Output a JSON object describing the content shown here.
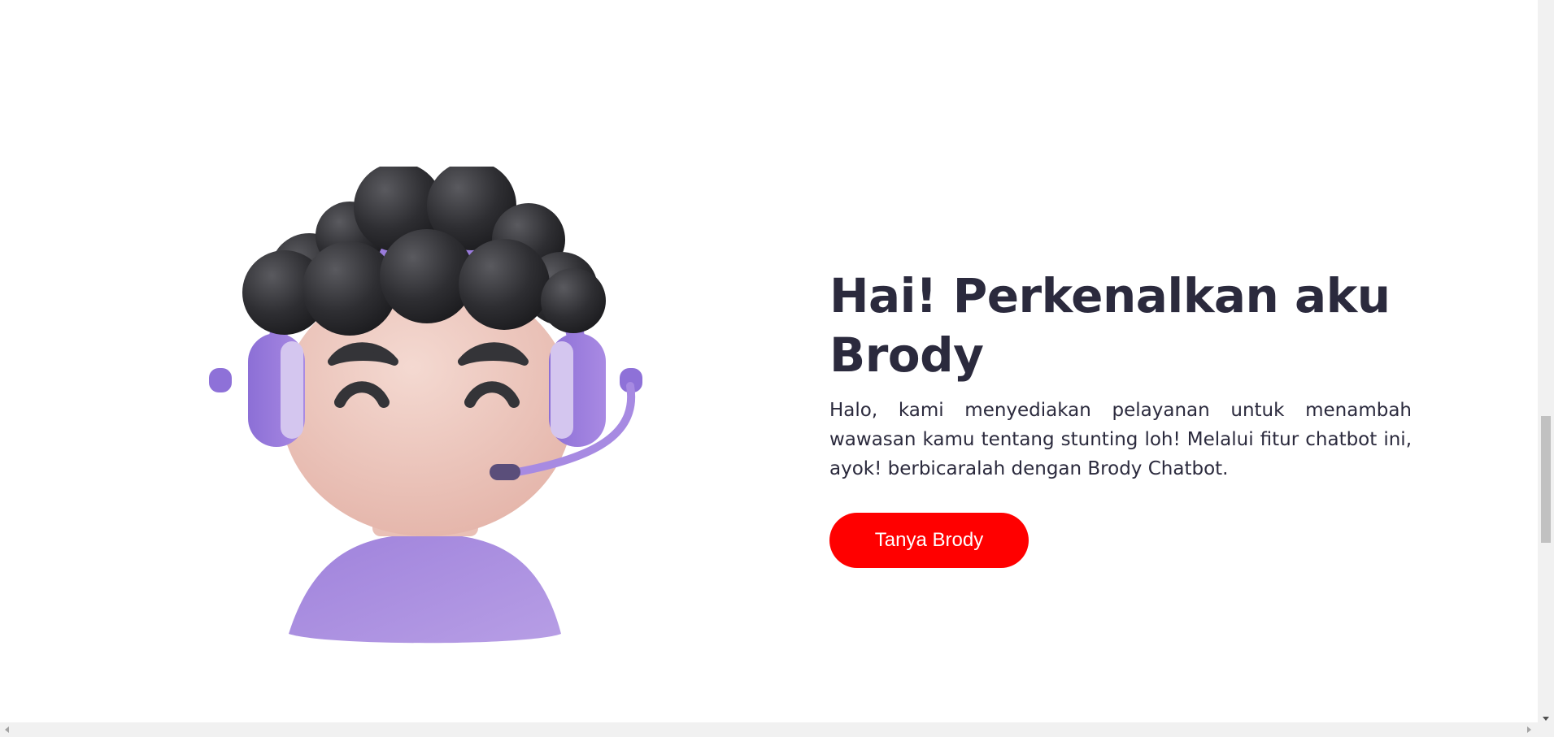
{
  "hero": {
    "title": "Hai! Perkenalkan aku Brody",
    "description": "Halo, kami menyediakan pelayanan untuk menambah wawasan kamu tentang stunting loh! Melalui fitur chatbot ini, ayok! berbicaralah dengan Brody Chatbot.",
    "cta_label": "Tanya Brody"
  },
  "mascot": {
    "icon": "customer-service-avatar-illustration"
  },
  "colors": {
    "text": "#2b2a3d",
    "cta_background": "#ff0000",
    "cta_text": "#ffffff",
    "accent_purple": "#9b7ddc",
    "skin": "#efcfc6",
    "hair": "#2f2f33"
  }
}
